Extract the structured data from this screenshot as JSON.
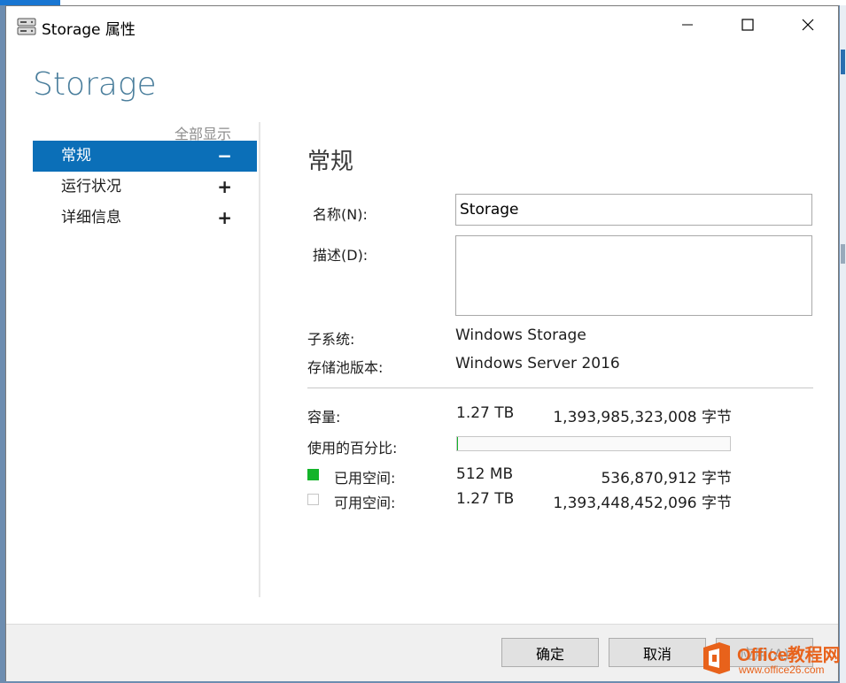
{
  "window": {
    "title": "Storage 属性"
  },
  "header": {
    "heading": "Storage",
    "show_all": "全部显示"
  },
  "nav": {
    "items": [
      {
        "label": "常规",
        "sign": "−",
        "active": true
      },
      {
        "label": "运行状况",
        "sign": "+"
      },
      {
        "label": "详细信息",
        "sign": "+"
      }
    ]
  },
  "general": {
    "section_title": "常规",
    "name_label": "名称(N):",
    "name_value": "Storage",
    "desc_label": "描述(D):",
    "desc_value": "",
    "subsystem_label": "子系统:",
    "subsystem_value": "Windows Storage",
    "pool_version_label": "存储池版本:",
    "pool_version_value": "Windows Server 2016"
  },
  "capacity": {
    "capacity_label": "容量:",
    "capacity_value": "1.27 TB",
    "capacity_bytes": "1,393,985,323,008 字节",
    "percent_used_label": "使用的百分比:",
    "percent_used_fraction": 0.0004,
    "used_label": "已用空间:",
    "used_value": "512 MB",
    "used_bytes": "536,870,912 字节",
    "free_label": "可用空间:",
    "free_value": "1.27 TB",
    "free_bytes": "1,393,448,452,096 字节",
    "used_color": "#14b42a",
    "free_color": "#ffffff"
  },
  "footer": {
    "ok": "确定",
    "cancel": "取消",
    "apply": "应用(A)"
  },
  "watermark": {
    "line1": "Office教程网",
    "line2": "www.office26.com"
  }
}
